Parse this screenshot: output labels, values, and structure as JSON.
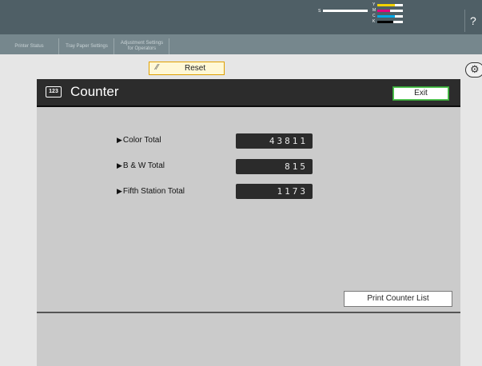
{
  "header": {
    "help_label": "?",
    "toner": [
      {
        "key": "S",
        "color": "#ffffff"
      },
      {
        "key": "Y",
        "color": "#f2d200"
      },
      {
        "key": "M",
        "color": "#e6007e"
      },
      {
        "key": "C",
        "color": "#00a8e8"
      },
      {
        "key": "K",
        "color": "#000000"
      }
    ]
  },
  "tabs": [
    {
      "label": "Printer Status"
    },
    {
      "label": "Tray Paper Settings"
    },
    {
      "label_line1": "Adjustment Settings",
      "label_line2": "for Operators"
    }
  ],
  "toolbar": {
    "reset_label": "Reset",
    "reset_icon": "reset-icon",
    "gear_icon": "gear-icon"
  },
  "panel": {
    "icon_text": "123",
    "title": "Counter",
    "exit_label": "Exit",
    "rows": [
      {
        "label": "Color Total",
        "value": "43811"
      },
      {
        "label": "B & W Total",
        "value": "815"
      },
      {
        "label": "Fifth Station Total",
        "value": "1173"
      }
    ],
    "print_button": "Print Counter List"
  },
  "colors": {
    "header_bg": "#4f5f66",
    "tab_bg": "#76878d",
    "panel_bg": "#cbcbcb",
    "panel_header": "#2c2c2c",
    "exit_border": "#39a339",
    "reset_border": "#e0a000"
  }
}
